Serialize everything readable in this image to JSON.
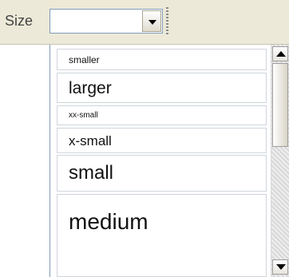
{
  "toolbar": {
    "size_label": "Size",
    "size_value": ""
  },
  "dropdown": {
    "options": [
      {
        "label": "smaller"
      },
      {
        "label": "larger"
      },
      {
        "label": "xx-small"
      },
      {
        "label": "x-small"
      },
      {
        "label": "small"
      },
      {
        "label": "medium"
      }
    ]
  },
  "icons": {
    "combo_arrow": "chevron-down-icon",
    "scroll_up": "arrow-up-icon",
    "scroll_down": "arrow-down-icon",
    "toolbar_grip": "grip-icon"
  },
  "colors": {
    "toolbar_bg": "#ece9d8",
    "field_border": "#7f9db9",
    "option_border": "#cfd5dc"
  }
}
